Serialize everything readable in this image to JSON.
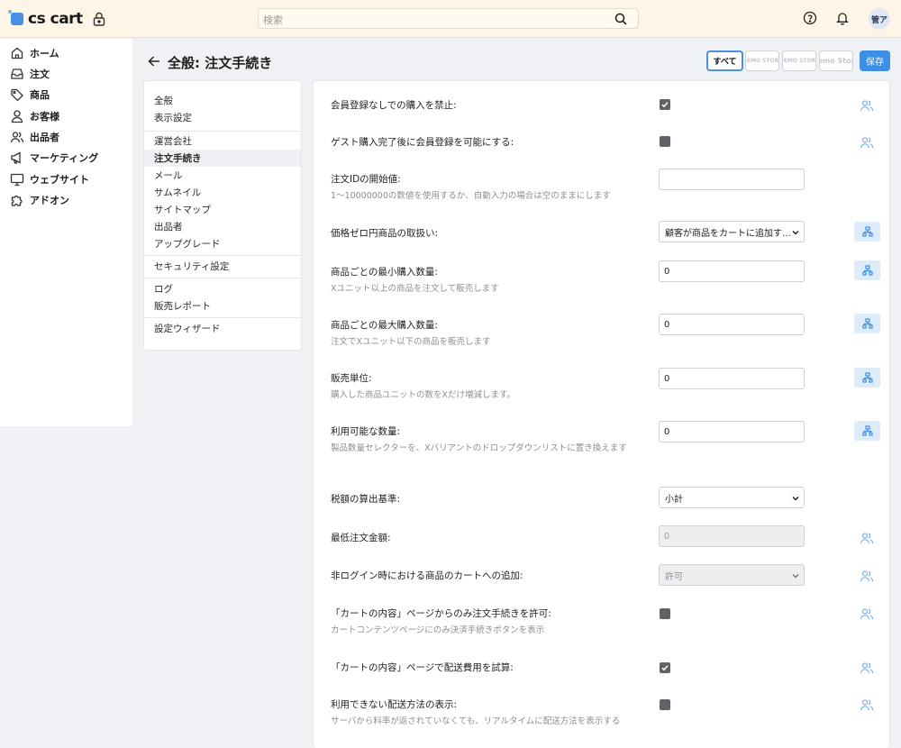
{
  "topbar": {
    "logo_text": "cs cart",
    "search_placeholder": "検索",
    "avatar_initials": "管ア",
    "icons": [
      "lock-icon",
      "search-icon",
      "help-icon",
      "bell-icon"
    ]
  },
  "nav": {
    "items": [
      {
        "label": "ホーム",
        "icon": "home-icon"
      },
      {
        "label": "注文",
        "icon": "inbox-icon"
      },
      {
        "label": "商品",
        "icon": "tag-icon"
      },
      {
        "label": "お客様",
        "icon": "user-icon"
      },
      {
        "label": "出品者",
        "icon": "users-icon"
      },
      {
        "label": "マーケティング",
        "icon": "megaphone-icon"
      },
      {
        "label": "ウェブサイト",
        "icon": "monitor-icon"
      },
      {
        "label": "アドオン",
        "icon": "puzzle-icon"
      }
    ]
  },
  "header": {
    "title": "全般: 注文手続き",
    "store_buttons": [
      "すべて",
      "DEMO STORE",
      "DEMO STORE",
      "emo Stor"
    ],
    "save_label": "保存"
  },
  "sections": {
    "items": [
      "全般",
      "表示設定",
      "運営会社",
      "注文手続き",
      "メール",
      "サムネイル",
      "サイトマップ",
      "出品者",
      "アップグレード",
      "セキュリティ設定",
      "ログ",
      "販売レポート",
      "設定ウィザード"
    ],
    "active": "注文手続き"
  },
  "settings": [
    {
      "label": "会員登録なしでの購入を禁止:",
      "desc": "",
      "control": "checkbox",
      "checked": true
    },
    {
      "label": "ゲスト購入完了後に会員登録を可能にする:",
      "desc": "",
      "control": "checkbox",
      "checked": false
    },
    {
      "label": "注文IDの開始値:",
      "desc": "1〜10000000の数値を使用するか、自動入力の場合は空のままにします",
      "control": "text",
      "value": ""
    },
    {
      "label": "価格ゼロ円商品の取扱い:",
      "desc": "",
      "control": "select",
      "value": "顧客が商品をカートに追加す…"
    },
    {
      "label": "商品ごとの最小購入数量:",
      "desc": "Xユニット以上の商品を注文して販売します",
      "control": "text",
      "value": "0"
    },
    {
      "label": "商品ごとの最大購入数量:",
      "desc": "注文でXユニット以下の商品を販売します",
      "control": "text",
      "value": "0"
    },
    {
      "label": "販売単位:",
      "desc": "購入した商品ユニットの数をXだけ増減します。",
      "control": "text",
      "value": "0"
    },
    {
      "label": "利用可能な数量:",
      "desc": "製品数量セレクターを、Xバリアントのドロップダウンリストに置き換えます",
      "control": "text",
      "value": "0"
    },
    {
      "label": "税額の算出基準:",
      "desc": "",
      "control": "select",
      "value": "小計"
    },
    {
      "label": "最低注文金額:",
      "desc": "",
      "control": "text-disabled",
      "value": "0"
    },
    {
      "label": "非ログイン時における商品のカートへの追加:",
      "desc": "",
      "control": "select-disabled",
      "value": "許可"
    },
    {
      "label": "「カートの内容」ページからのみ注文手続きを許可:",
      "desc": "カートコンテンツページにのみ決済手続きボタンを表示",
      "control": "checkbox",
      "checked": false
    },
    {
      "label": "「カートの内容」ページで配送費用を試算:",
      "desc": "",
      "control": "checkbox",
      "checked": true
    },
    {
      "label": "利用できない配送方法の表示:",
      "desc": "サーバから料率が返されていなくても、リアルタイムに配送方法を表示する",
      "control": "checkbox",
      "checked": false
    }
  ],
  "colors": {
    "topbar_bg": "#fdf5e6",
    "accent": "#3d8fe6",
    "share_bg": "#deebf8"
  }
}
